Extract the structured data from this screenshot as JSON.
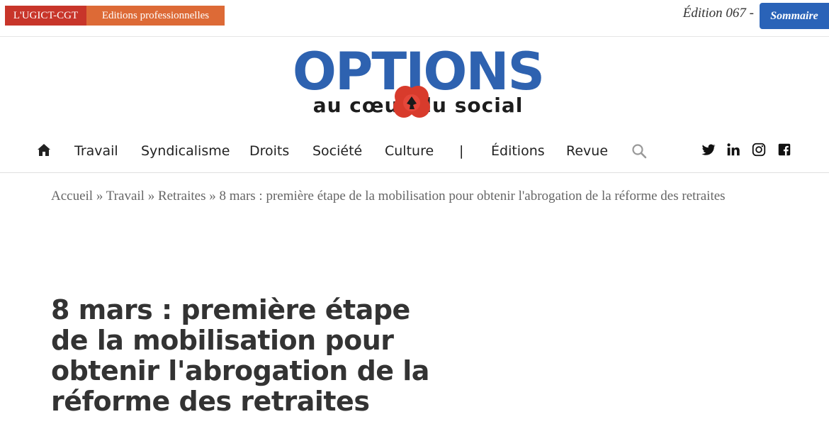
{
  "topbar": {
    "tag_ugict": "L'UGICT-CGT",
    "tag_editions": "Editions professionnelles",
    "edition": "Édition 067 -",
    "sommaire": "Sommaire"
  },
  "logo": {
    "main": "OPTIONS",
    "sub": "au cœur du social"
  },
  "nav": {
    "items": [
      "Travail",
      "Syndicalisme",
      "Droits",
      "Société",
      "Culture",
      "|",
      "Éditions",
      "Revue"
    ]
  },
  "breadcrumb": {
    "items": [
      "Accueil",
      "Travail",
      "Retraites",
      "8 mars  : première étape de la mobilisation pour obtenir l'abrogation de la réforme des retraites"
    ],
    "separator": "»"
  },
  "article": {
    "title": "8 mars  : première étape de la mobilisation pour obtenir l'abrogation de la réforme des retraites"
  },
  "colors": {
    "ugict_red": "#c8352a",
    "editions_orange": "#dd6a36",
    "brand_blue": "#2e62b0"
  },
  "icons": [
    "home-icon",
    "search-icon",
    "twitter-icon",
    "linkedin-icon",
    "instagram-icon",
    "facebook-icon"
  ]
}
